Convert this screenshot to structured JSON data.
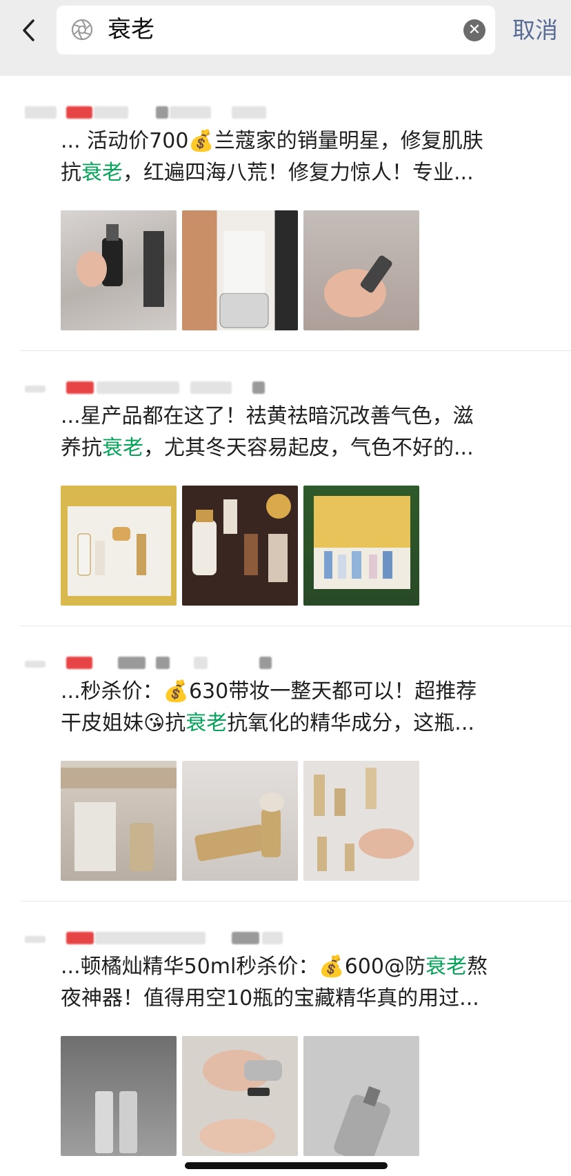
{
  "search": {
    "query": "衰老",
    "cancel_label": "取消"
  },
  "results": [
    {
      "line1": "... 活动价700💰兰蔻家的销量明星，修复肌肤",
      "line2_pre": "抗",
      "line2_hl": "衰老",
      "line2_post": "，红遍四海八荒！修复力惊人！专业...",
      "images": [
        "#c9c6c4",
        "#bdb5ab",
        "#b8afa9"
      ]
    },
    {
      "line1": "...星产品都在这了！祛黄祛暗沉改善气色，滋",
      "line2_pre": "养抗",
      "line2_hl": "衰老",
      "line2_post": "，尤其冬天容易起皮，气色不好的...",
      "images": [
        "#d4b24a",
        "#3c2a22",
        "#3f6a3a"
      ]
    },
    {
      "line1": "...秒杀价：💰630带妆一整天都可以！超推荐",
      "line2_pre": "干皮姐妹😘抗",
      "line2_hl": "衰老",
      "line2_post": "抗氧化的精华成分，这瓶...",
      "images": [
        "#c9c1b7",
        "#d8d3cf",
        "#dfdad6"
      ]
    },
    {
      "line1_pre": "...顿橘灿精华50ml秒杀价：💰600@防",
      "line1_hl": "衰老",
      "line1_post": "熬",
      "line2_pre": "夜神器！值得用空10瓶的宝藏精华真的用过...",
      "line2_hl": "",
      "line2_post": "",
      "images": [
        "#8d8d8d",
        "#d2cbc6",
        "#c7c7c7"
      ]
    }
  ],
  "colors": {
    "highlight": "#07a35a",
    "cancel": "#576b95"
  }
}
